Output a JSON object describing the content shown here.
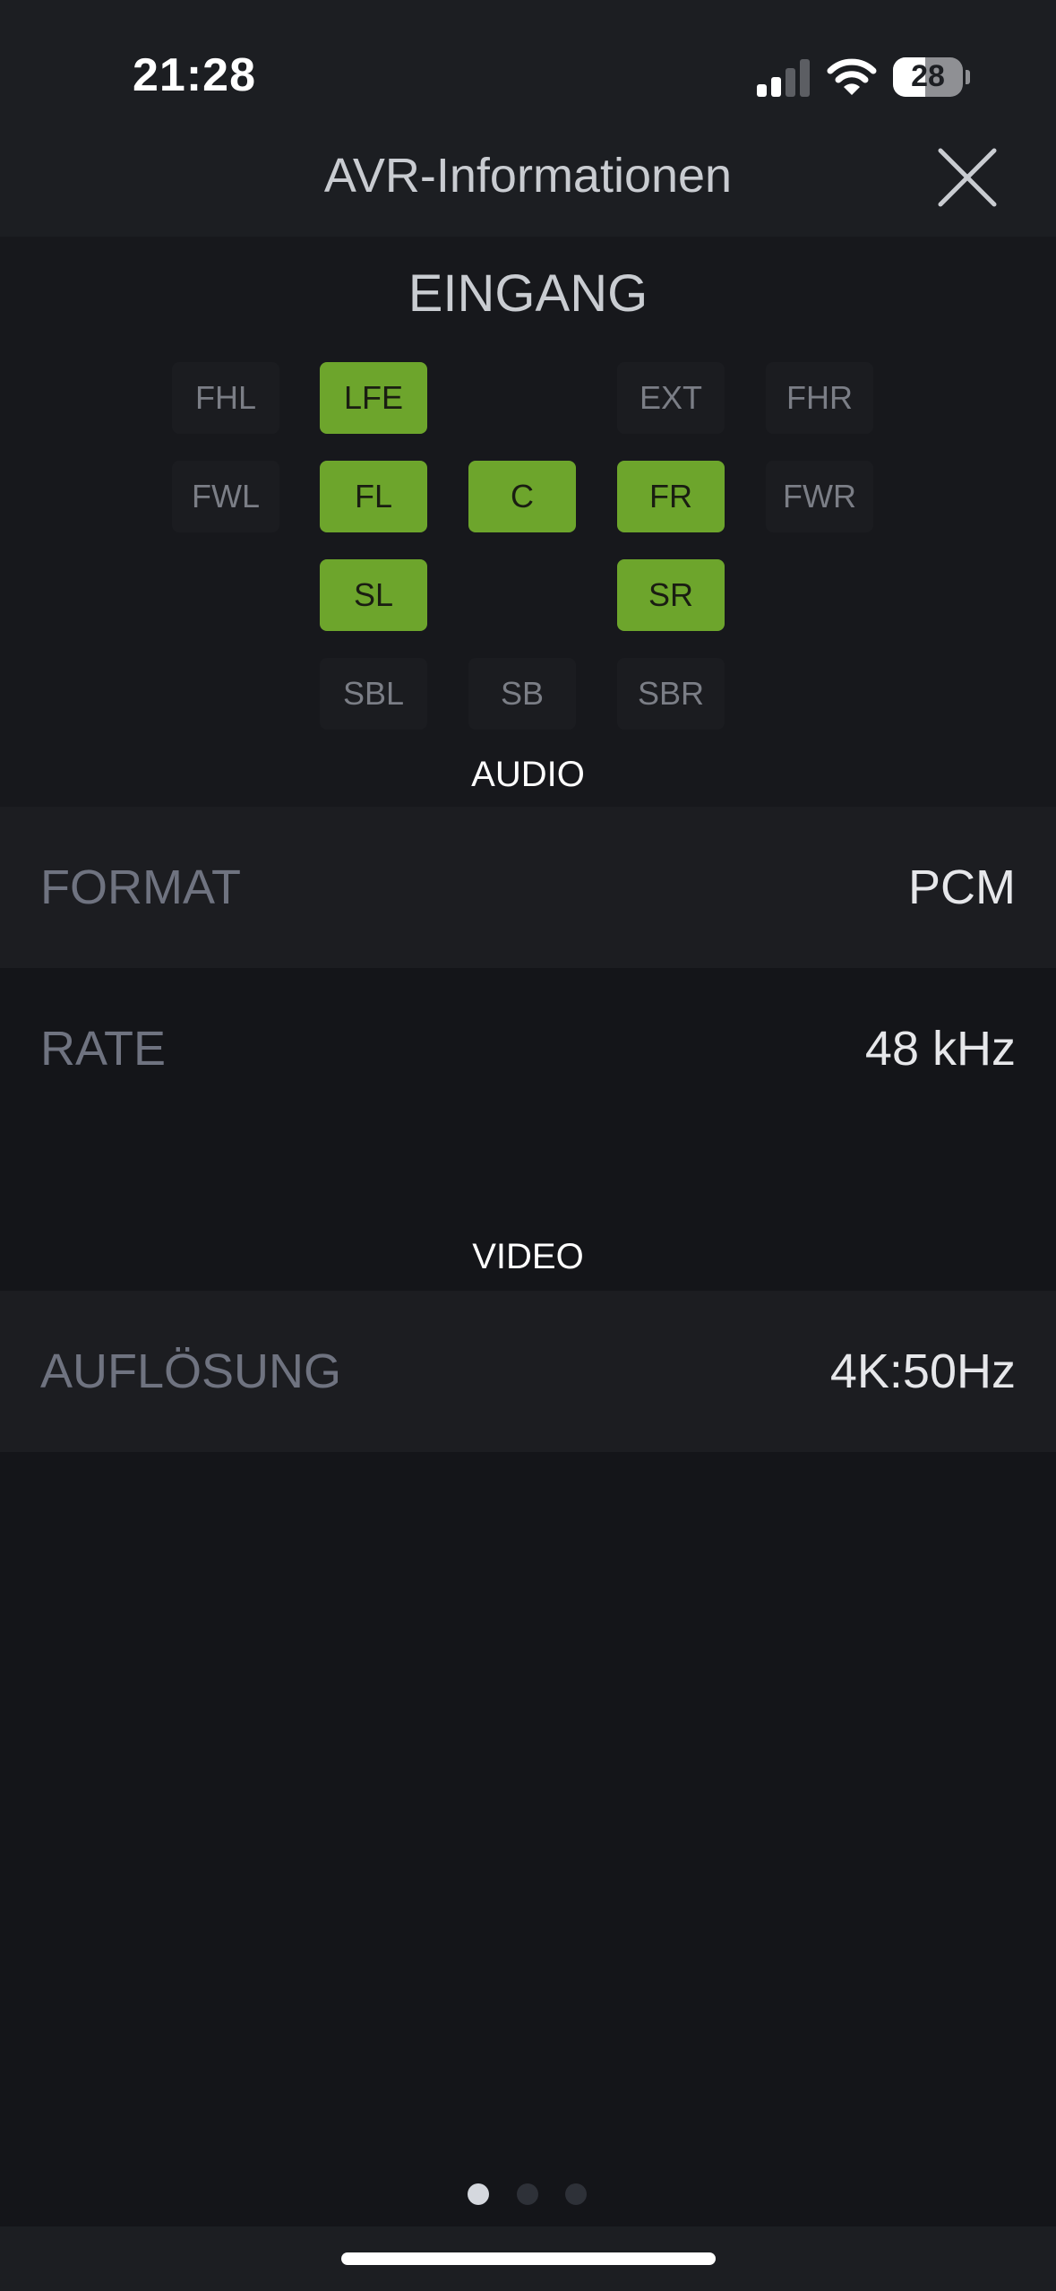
{
  "status_bar": {
    "time": "21:28",
    "battery_level": "28",
    "icons": [
      "cellular-signal-icon",
      "wifi-icon",
      "battery-icon"
    ]
  },
  "header": {
    "title": "AVR-Informationen",
    "close_icon": "close-icon"
  },
  "input": {
    "title": "EINGANG",
    "channels": [
      {
        "label": "FHL",
        "active": false
      },
      {
        "label": "LFE",
        "active": true
      },
      {
        "label": "EXT",
        "active": false
      },
      {
        "label": "FHR",
        "active": false
      },
      {
        "label": "FWL",
        "active": false
      },
      {
        "label": "FL",
        "active": true
      },
      {
        "label": "C",
        "active": true
      },
      {
        "label": "FR",
        "active": true
      },
      {
        "label": "FWR",
        "active": false
      },
      {
        "label": "SL",
        "active": true
      },
      {
        "label": "SR",
        "active": true
      },
      {
        "label": "SBL",
        "active": false
      },
      {
        "label": "SB",
        "active": false
      },
      {
        "label": "SBR",
        "active": false
      }
    ]
  },
  "audio": {
    "section_label": "AUDIO",
    "rows": [
      {
        "label": "FORMAT",
        "value": "PCM"
      },
      {
        "label": "RATE",
        "value": "48 kHz"
      }
    ]
  },
  "video": {
    "section_label": "VIDEO",
    "rows": [
      {
        "label": "AUFLÖSUNG",
        "value": "4K:50Hz"
      }
    ]
  },
  "pagination": {
    "pages": 3,
    "current": 1
  },
  "colors": {
    "active_channel": "#6da52c",
    "inactive_channel": "#1b1c20",
    "background": "#141519",
    "header_background": "#1c1e22"
  }
}
